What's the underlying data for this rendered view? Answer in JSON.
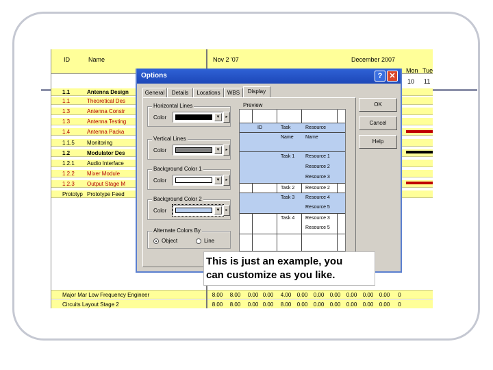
{
  "gantt": {
    "col_id": "ID",
    "col_name": "Name",
    "timescale_left": "Nov 2 '07",
    "timescale_right": "December 2007",
    "day_mon": "Mon",
    "day_tue": "Tue",
    "date_10": "10",
    "date_11": "11",
    "tasks": [
      {
        "id": "1.1",
        "name": "Antenna Design"
      },
      {
        "id": "1.1",
        "name": "Theoretical Des"
      },
      {
        "id": "1.3",
        "name": "Antenna Constr"
      },
      {
        "id": "1.3",
        "name": "Antenna Testing"
      },
      {
        "id": "1.4",
        "name": "Antenna Packa"
      },
      {
        "id": "1.1.5",
        "name": "Monitoring"
      },
      {
        "id": "1.2",
        "name": "Modulator Des"
      },
      {
        "id": "1.2.1",
        "name": "Audio Interface"
      },
      {
        "id": "1.2.2",
        "name": "Mixer Module"
      },
      {
        "id": "1.2.3",
        "name": "Output Stage M"
      },
      {
        "id": "Prototyp",
        "name": "Prototype Feed"
      }
    ],
    "resources": [
      {
        "name": "Major Mar Low Frequency Engineer",
        "values": [
          "8.00",
          "8.00",
          "0.00",
          "0.00",
          "4.00",
          "0.00",
          "0.00",
          "0.00",
          "0.00",
          "0.00",
          "0.00",
          "0"
        ]
      },
      {
        "name": "Circuits Layout Stage 2",
        "values": [
          "8.00",
          "8.00",
          "0.00",
          "0.00",
          "8.00",
          "0.00",
          "0.00",
          "0.00",
          "0.00",
          "0.00",
          "0.00",
          "0"
        ]
      }
    ]
  },
  "dialog": {
    "title": "Options",
    "help_glyph": "?",
    "close_glyph": "✕",
    "tabs": [
      "General",
      "Details",
      "Locations",
      "WBS",
      "Display"
    ],
    "groups": {
      "horizontal": "Horizontal Lines",
      "vertical": "Vertical Lines",
      "background1": "Background Color 1",
      "background2": "Background Color 2",
      "alternate": "Alternate Colors By"
    },
    "color_label": "Color",
    "radio_object": "Object",
    "radio_line": "Line",
    "preview_label": "Preview",
    "preview": {
      "headers": [
        "ID",
        "Task",
        "Resource"
      ],
      "row_name": {
        "task": "Name",
        "resource": "Name"
      },
      "rows": [
        {
          "task": "Task 1",
          "resource": "Resource 1"
        },
        {
          "task": "",
          "resource": "Resource 2"
        },
        {
          "task": "",
          "resource": "Resource 3"
        },
        {
          "task": "Task 2",
          "resource": "Resource 2"
        },
        {
          "task": "Task 3",
          "resource": "Resource 4"
        },
        {
          "task": "",
          "resource": "Resource 5"
        },
        {
          "task": "Task 4",
          "resource": "Resource 3"
        },
        {
          "task": "",
          "resource": "Resource 5"
        }
      ]
    },
    "buttons": {
      "ok": "OK",
      "cancel": "Cancel",
      "help": "Help"
    },
    "colors": {
      "horizontal": "#000000",
      "vertical": "#808080",
      "background1": "#ffffff",
      "background2": "#b9cff0"
    }
  },
  "callout": {
    "line1": "This is just an example, you",
    "line2": "can customize as you like."
  }
}
